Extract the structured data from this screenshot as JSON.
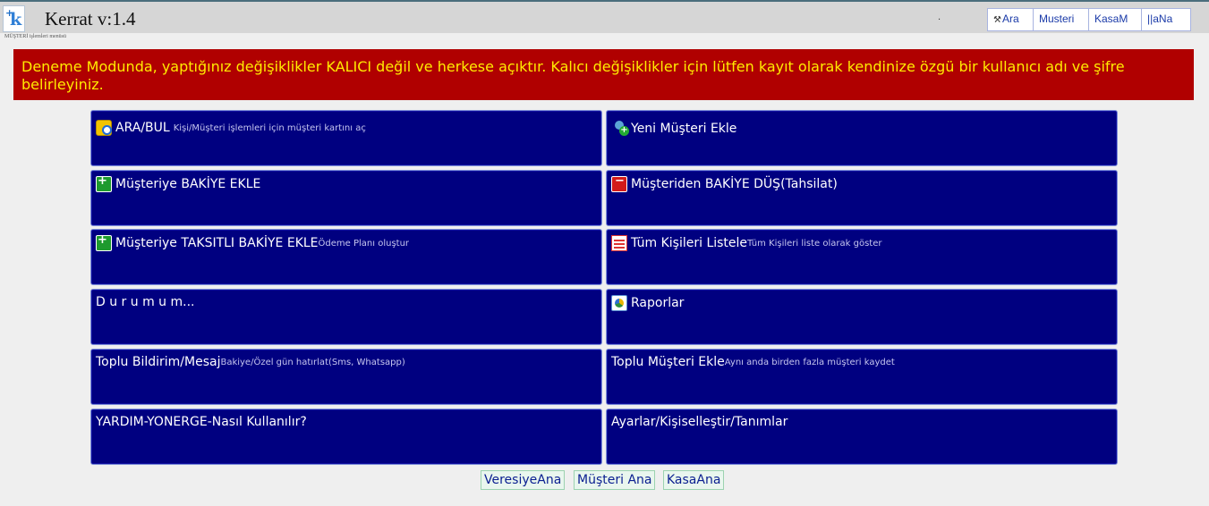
{
  "app": {
    "title": "Kerrat v:1.4",
    "subcaption": "MÜŞTERİ işlemleri menüsü",
    "header_dot": "."
  },
  "topnav": {
    "items": [
      {
        "label": "Ara",
        "icon": "binoculars-icon"
      },
      {
        "label": "Musteri"
      },
      {
        "label": "KasaM"
      },
      {
        "label": "||aNa"
      }
    ]
  },
  "warning": {
    "text": "Deneme Modunda, yaptığınız değişiklikler KALICI değil ve herkese açıktır. Kalıcı değişiklikler için lütfen kayıt olarak kendinize özgü bir kullanıcı adı ve şifre belirleyiniz.",
    "bg_color": "#b00000",
    "text_color": "#ffeb00"
  },
  "tiles": [
    {
      "label": "ARA/BUL",
      "desc": "Kişi/Müşteri işlemleri için müşteri kartını aç",
      "icon": "search-user-icon"
    },
    {
      "label": "Yeni Müşteri Ekle",
      "desc": "",
      "icon": "user-add-icon"
    },
    {
      "label": "Müşteriye BAKİYE EKLE",
      "desc": "",
      "icon": "wallet-plus-icon"
    },
    {
      "label": "Müşteriden BAKİYE DÜŞ(Tahsilat)",
      "desc": "",
      "icon": "wallet-minus-icon"
    },
    {
      "label": "Müşteriye TAKSITLI BAKİYE EKLE",
      "desc": "Ödeme Planı oluştur",
      "icon": "wallet-plus-icon"
    },
    {
      "label": "Tüm Kişileri Listele",
      "desc": "Tüm Kişileri liste olarak göster",
      "icon": "list-icon"
    },
    {
      "label": "D u r u m u m...",
      "desc": ""
    },
    {
      "label": "Raporlar",
      "desc": "",
      "icon": "report-icon"
    },
    {
      "label": "Toplu Bildirim/Mesaj",
      "desc": "Bakiye/Özel gün hatırlat(Sms, Whatsapp)"
    },
    {
      "label": "Toplu Müşteri Ekle",
      "desc": "Aynı anda birden fazla müşteri kaydet"
    },
    {
      "label": "YARDIM-YONERGE-Nasıl Kullanılır?",
      "desc": ""
    },
    {
      "label": "Ayarlar/Kişiselleştir/Tanımlar",
      "desc": ""
    }
  ],
  "bottom_links": [
    {
      "label": "VeresiyeAna"
    },
    {
      "label": "Müşteri Ana"
    },
    {
      "label": "KasaAna"
    }
  ],
  "colors": {
    "tile_bg": "#000080",
    "tile_border": "#7d8fd6",
    "page_bg": "#efefef"
  }
}
